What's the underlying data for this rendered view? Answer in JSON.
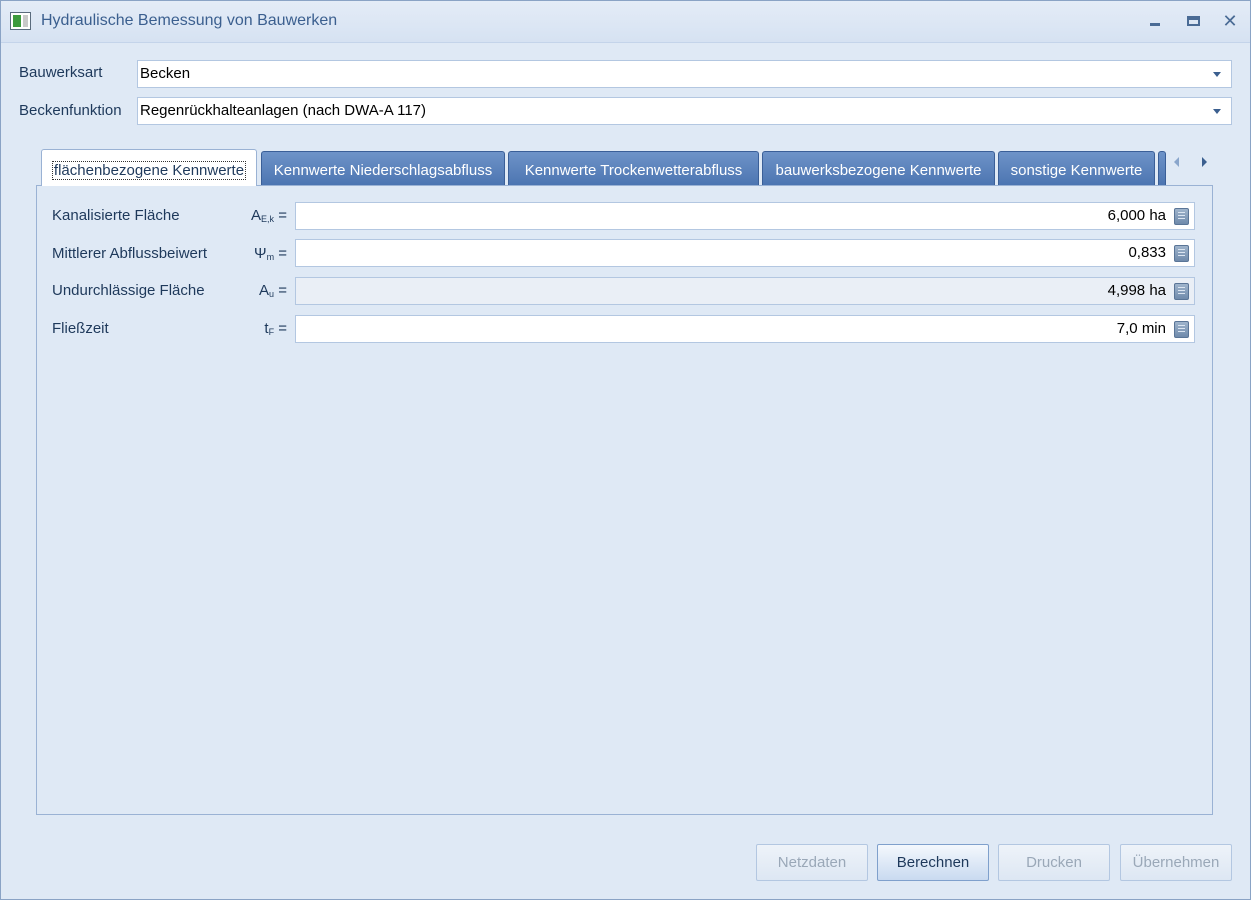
{
  "window": {
    "title": "Hydraulische Bemessung von Bauwerken",
    "controls": [
      "minimize-icon",
      "maximize-icon",
      "close-icon"
    ]
  },
  "header": {
    "bauwerksart": {
      "label": "Bauwerksart",
      "value": "Becken"
    },
    "beckenfunktion": {
      "label": "Beckenfunktion",
      "value": "Regenrückhalteanlagen (nach DWA-A 117)"
    }
  },
  "tabs": [
    {
      "label": "flächenbezogene Kennwerte",
      "active": true
    },
    {
      "label": "Kennwerte Niederschlagsabfluss",
      "active": false
    },
    {
      "label": "Kennwerte Trockenwetterabfluss",
      "active": false
    },
    {
      "label": "bauwerksbezogene Kennwerte",
      "active": false
    },
    {
      "label": "sonstige Kennwerte",
      "active": false
    }
  ],
  "rows": [
    {
      "label": "Kanalisierte Fläche",
      "symbol": "A",
      "sub": "E,k",
      "eq": " =",
      "value": "6,000 ha",
      "readonly": false
    },
    {
      "label": "Mittlerer Abflussbeiwert",
      "symbol": "Ψ",
      "sub": "m",
      "eq": " =",
      "value": "0,833",
      "readonly": false
    },
    {
      "label": "Undurchlässige Fläche",
      "symbol": "A",
      "sub": "u",
      "eq": " =",
      "value": "4,998 ha",
      "readonly": true
    },
    {
      "label": "Fließzeit",
      "symbol": "t",
      "sub": "F",
      "eq": " =",
      "value": "7,0 min",
      "readonly": false
    }
  ],
  "buttons": {
    "netzdaten": "Netzdaten",
    "berechnen": "Berechnen",
    "drucken": "Drucken",
    "uebernehmen": "Übernehmen"
  },
  "colors": {
    "tab_blue": "#5a80b9",
    "text": "#1e395b",
    "background": "#dfe9f5"
  }
}
